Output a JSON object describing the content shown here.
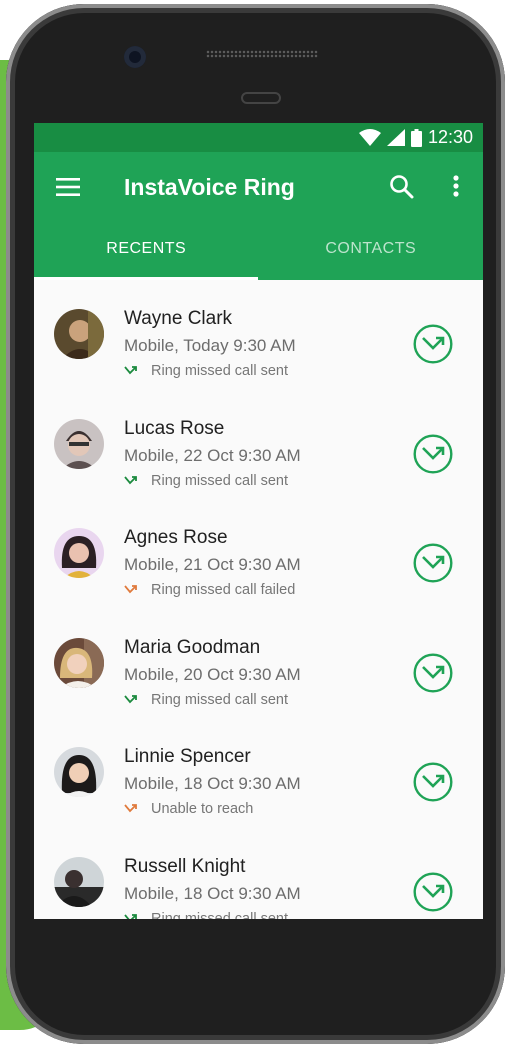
{
  "status_bar": {
    "time": "12:30"
  },
  "app_bar": {
    "title": "InstaVoice Ring"
  },
  "tabs": [
    {
      "label": "RECENTS",
      "active": true
    },
    {
      "label": "CONTACTS",
      "active": false
    }
  ],
  "colors": {
    "primary": "#1fa356",
    "primary_dark": "#188d43",
    "sent_icon": "#1b8a3e",
    "failed_icon": "#e07a3c"
  },
  "recents": [
    {
      "name": "Wayne Clark",
      "detail": "Mobile, Today 9:30 AM",
      "status": "Ring missed call sent",
      "status_type": "sent"
    },
    {
      "name": "Lucas Rose",
      "detail": "Mobile, 22 Oct 9:30 AM",
      "status": "Ring missed call sent",
      "status_type": "sent"
    },
    {
      "name": "Agnes Rose",
      "detail": "Mobile, 21 Oct 9:30 AM",
      "status": "Ring missed call failed",
      "status_type": "failed"
    },
    {
      "name": "Maria Goodman",
      "detail": "Mobile, 20 Oct 9:30 AM",
      "status": "Ring missed call sent",
      "status_type": "sent"
    },
    {
      "name": "Linnie Spencer",
      "detail": "Mobile, 18 Oct 9:30 AM",
      "status": "Unable to reach",
      "status_type": "failed"
    },
    {
      "name": "Russell Knight",
      "detail": "Mobile, 18 Oct 9:30 AM",
      "status": "Ring missed call sent",
      "status_type": "sent"
    }
  ]
}
